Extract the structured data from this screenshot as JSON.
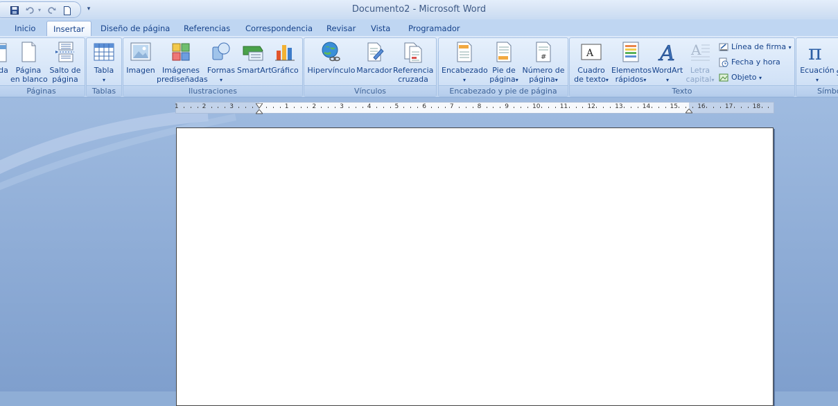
{
  "window": {
    "title": "Documento2 - Microsoft Word"
  },
  "qat": {
    "icons": [
      "save-icon",
      "undo-icon",
      "redo-icon",
      "new-document-icon",
      "customize-qat-icon"
    ]
  },
  "tabs": [
    "Inicio",
    "Insertar",
    "Diseño de página",
    "Referencias",
    "Correspondencia",
    "Revisar",
    "Vista",
    "Programador"
  ],
  "active_tab": "Insertar",
  "groups": {
    "paginas": {
      "label": "Páginas",
      "portada_partial": "da",
      "pagina_en_blanco": [
        "Página",
        "en blanco"
      ],
      "salto_de_pagina": [
        "Salto de",
        "página"
      ]
    },
    "tablas": {
      "label": "Tablas",
      "tabla": "Tabla"
    },
    "ilustraciones": {
      "label": "Ilustraciones",
      "imagen": "Imagen",
      "imagenes_prediseñadas": [
        "Imágenes",
        "prediseñadas"
      ],
      "formas": "Formas",
      "smartart": "SmartArt",
      "grafico": "Gráfico"
    },
    "vinculos": {
      "label": "Vínculos",
      "hipervinculo": "Hipervínculo",
      "marcador": "Marcador",
      "referencia_cruzada": [
        "Referencia",
        "cruzada"
      ]
    },
    "encabezado": {
      "label": "Encabezado y pie de página",
      "encabezado": "Encabezado",
      "pie_de_pagina": [
        "Pie de",
        "página"
      ],
      "numero_de_pagina": [
        "Número de",
        "página"
      ]
    },
    "texto": {
      "label": "Texto",
      "cuadro_de_texto": [
        "Cuadro",
        "de texto"
      ],
      "elementos_rapidos": [
        "Elementos",
        "rápidos"
      ],
      "wordart": "WordArt",
      "letra_capital": [
        "Letra",
        "capital"
      ],
      "linea_de_firma": "Línea de firma",
      "fecha_y_hora": "Fecha y hora",
      "objeto": "Objeto"
    },
    "simbolos": {
      "label_partial": "Símbo",
      "ecuacion": "Ecuación",
      "simbolo_partial": "S"
    }
  },
  "ruler": {
    "numbers_left": [
      "3",
      "2",
      "1"
    ],
    "numbers_right": [
      "1",
      "2",
      "3",
      "4",
      "5",
      "6",
      "7",
      "8",
      "9",
      "10",
      "11",
      "12",
      "13",
      "14",
      "15",
      "16",
      "17",
      "18"
    ]
  },
  "colors": {
    "accent": "#15428b",
    "workspace": "#8faed6"
  }
}
